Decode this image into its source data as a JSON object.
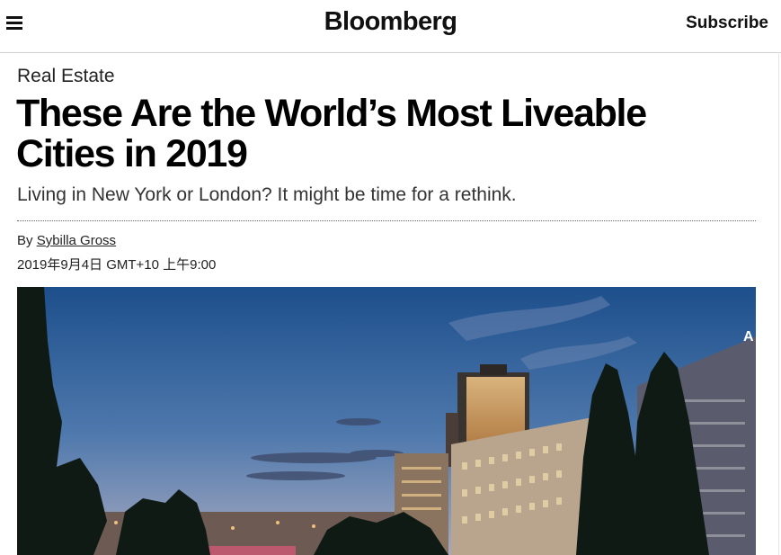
{
  "header": {
    "brand": "Bloomberg",
    "subscribe_label": "Subscribe",
    "menu_icon": "hamburger-icon"
  },
  "article": {
    "section": "Real Estate",
    "headline_line1": "These Are the World’s Most Liveable",
    "headline_line2": "Cities in 2019",
    "dek": "Living in New York or London? It might be time for a rethink.",
    "byline_prefix": "By ",
    "author": "Sybilla Gross",
    "timestamp": "2019年9月4日 GMT+10 上午9:00"
  },
  "hero_image": {
    "sign_letter": "A",
    "sky_top": "#1d4f8c",
    "sky_bottom": "#a7a9bf",
    "foliage": "#0f1a14"
  }
}
